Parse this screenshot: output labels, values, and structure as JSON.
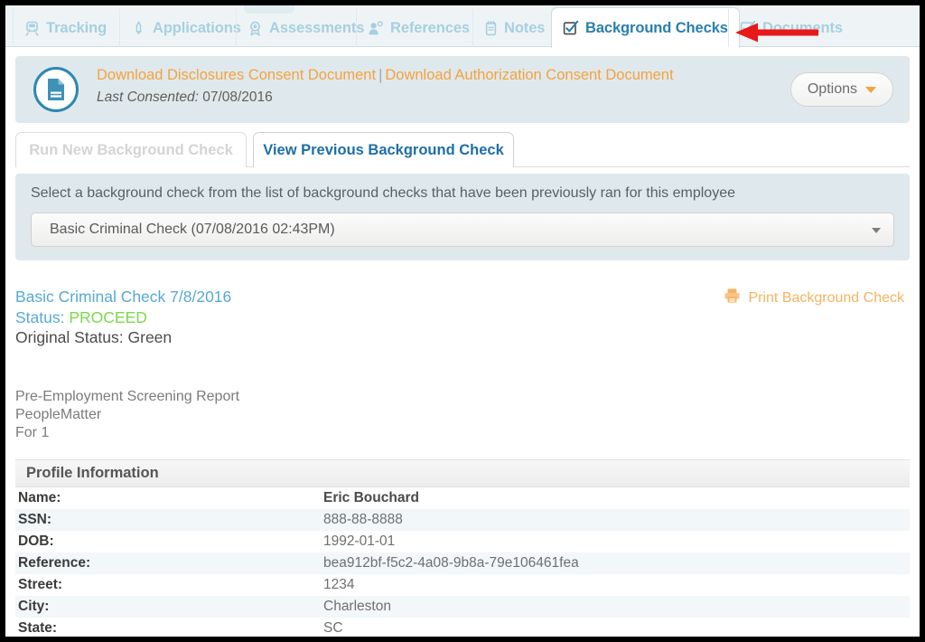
{
  "main_tabs": [
    {
      "label": "Tracking",
      "icon": "tracking-icon",
      "active": false
    },
    {
      "label": "Applications",
      "icon": "pen-icon",
      "active": false
    },
    {
      "label": "Assessments",
      "icon": "award-ribbon-icon",
      "active": false
    },
    {
      "label": "References",
      "icon": "person-reference-icon",
      "active": false
    },
    {
      "label": "Notes",
      "icon": "notepad-icon",
      "active": false
    },
    {
      "label": "Background Checks",
      "icon": "checkbox-checked-icon",
      "active": true
    },
    {
      "label": "Documents",
      "icon": "checkbox-icon",
      "active": false
    }
  ],
  "banner": {
    "doc_icon": "document-circle-icon",
    "disclosures_link": "Download Disclosures Consent Document",
    "separator": "|",
    "authorization_link": "Download Authorization Consent Document",
    "last_consented_label": "Last Consented:",
    "last_consented_value": "07/08/2016",
    "options_label": "Options"
  },
  "sub_tabs": [
    {
      "label": "Run New Background Check",
      "active": false
    },
    {
      "label": "View Previous Background Check",
      "active": true
    }
  ],
  "selector": {
    "instruction": "Select a background check from the list of background checks that have been previously ran for this employee",
    "selected_value": "Basic Criminal Check (07/08/2016 02:43PM)"
  },
  "result": {
    "title": "Basic Criminal Check 7/8/2016",
    "status_label": "Status:",
    "status_value": "PROCEED",
    "original_status": "Original Status: Green",
    "print_label": "Print Background Check",
    "print_icon": "printer-icon"
  },
  "report_meta": {
    "line1": "Pre-Employment Screening Report",
    "line2": "PeopleMatter",
    "line3": "For 1"
  },
  "profile": {
    "section_title": "Profile Information",
    "rows": [
      {
        "key": "Name:",
        "value": "Eric Bouchard"
      },
      {
        "key": "SSN:",
        "value": "888-88-8888"
      },
      {
        "key": "DOB:",
        "value": "1992-01-01"
      },
      {
        "key": "Reference:",
        "value": "bea912bf-f5c2-4a08-9b8a-79e106461fea"
      },
      {
        "key": "Street:",
        "value": "1234"
      },
      {
        "key": "City:",
        "value": "Charleston"
      },
      {
        "key": "State:",
        "value": "SC"
      }
    ]
  },
  "annotation": {
    "arrow": "red-left-arrow",
    "color": "#e81919"
  },
  "colors": {
    "accent_blue": "#2a7fae",
    "tab_inactive_blue": "#a8cfe0",
    "orange_link": "#f5a23c",
    "status_green": "#7cd94b",
    "panel_blue_grey": "#dfe9ed"
  }
}
